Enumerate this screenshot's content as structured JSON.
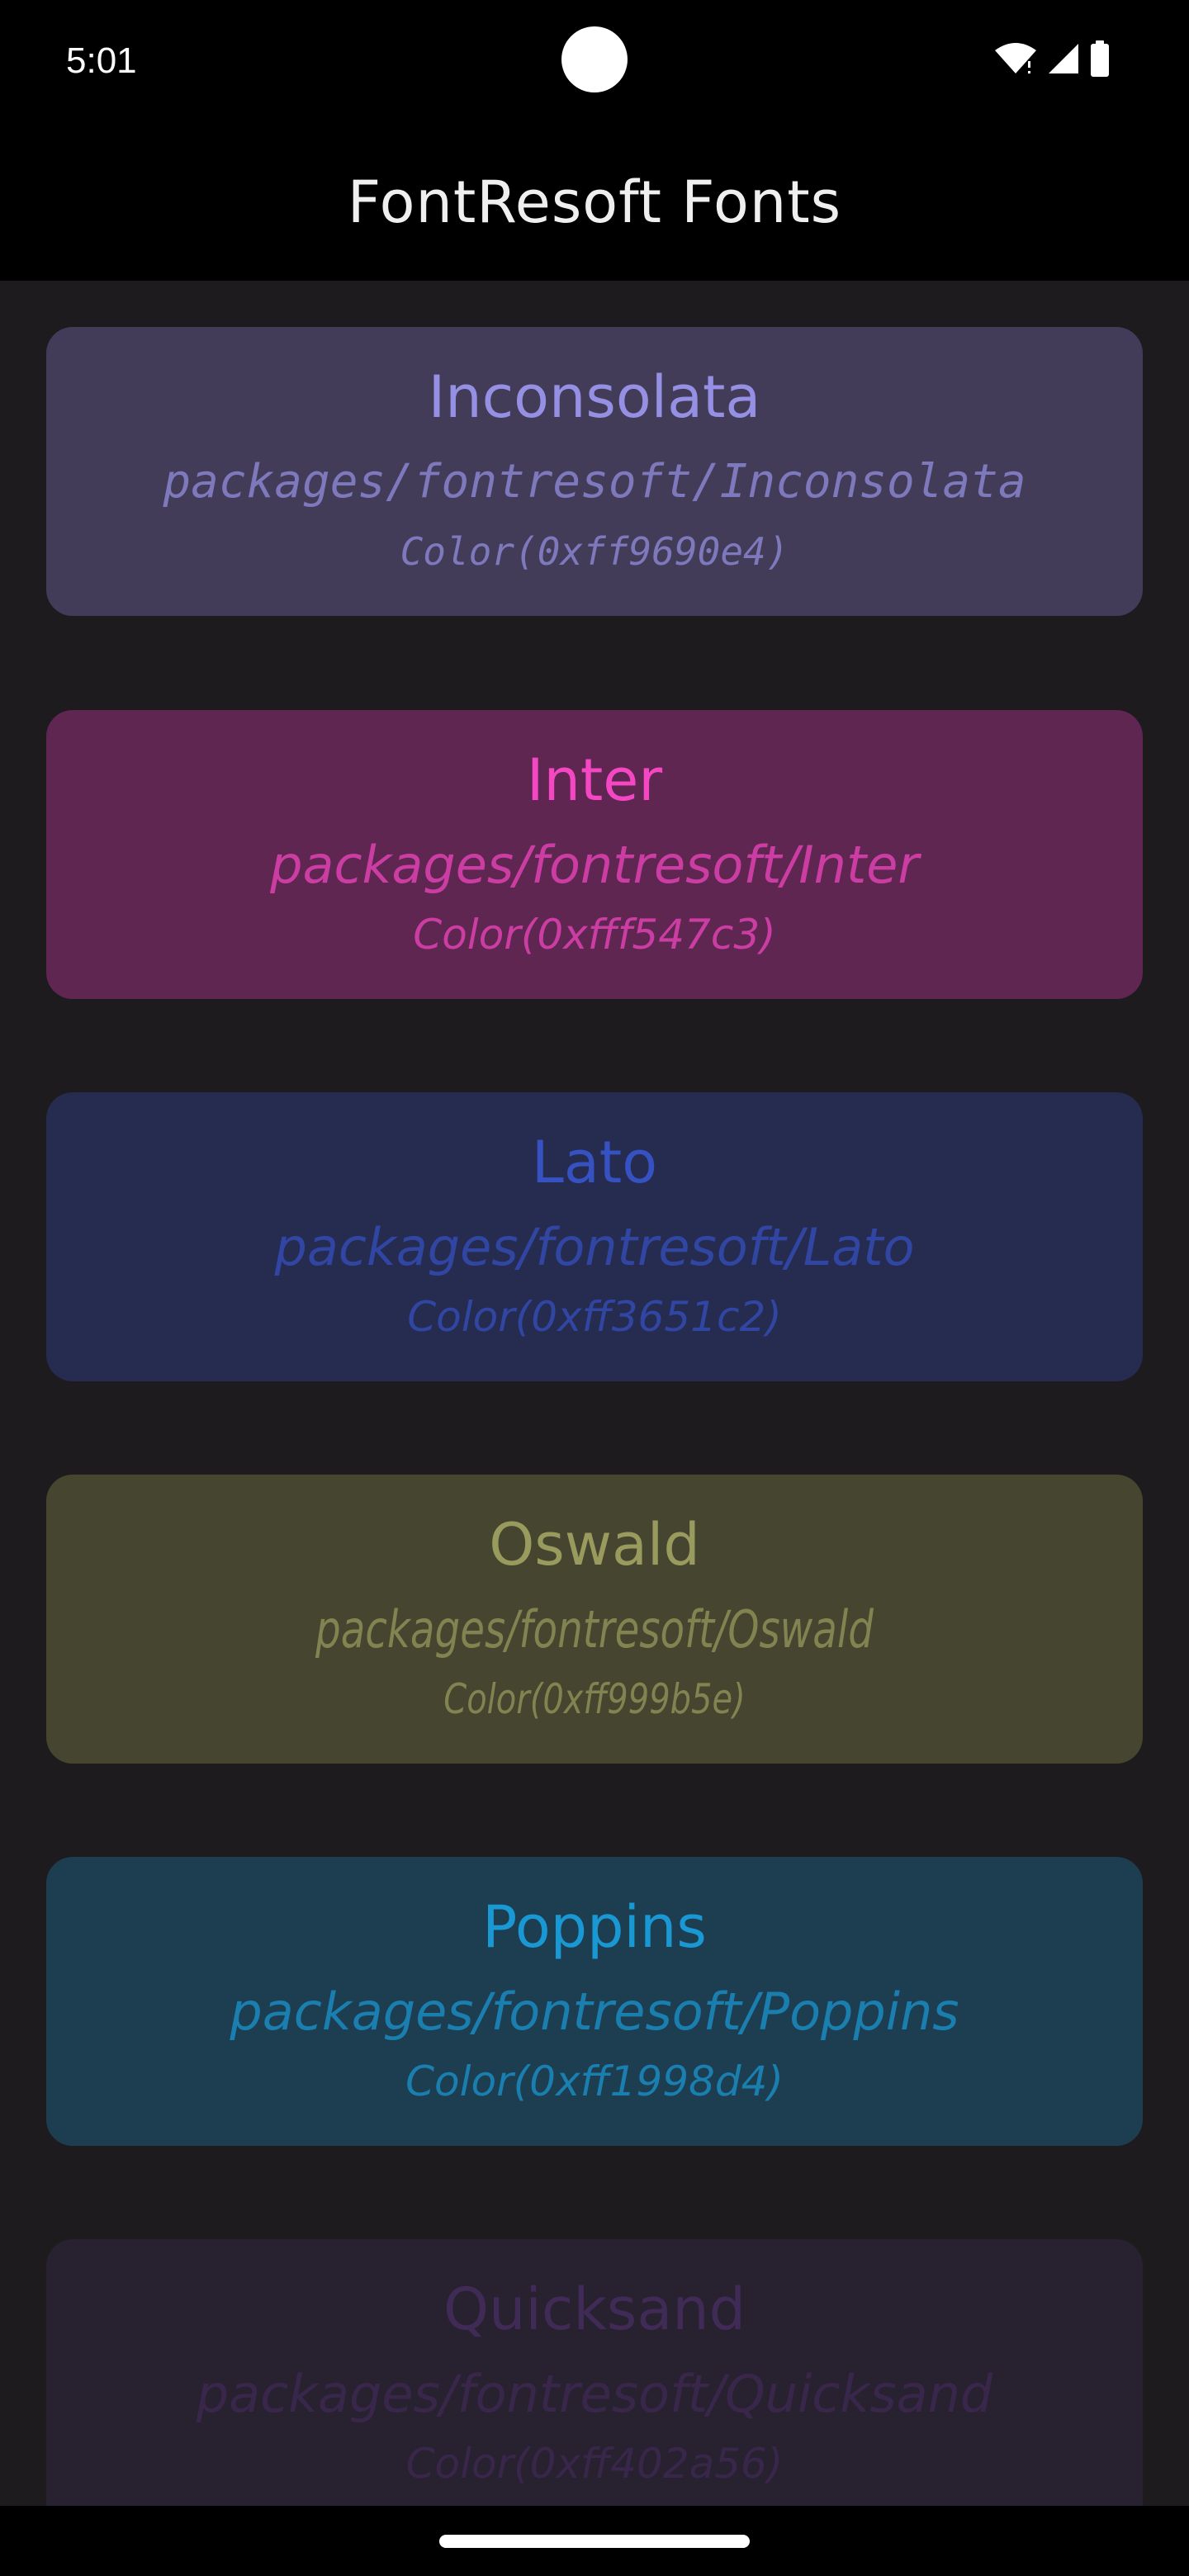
{
  "status_bar": {
    "time": "5:01",
    "icons": [
      "wifi-icon",
      "signal-icon",
      "battery-icon"
    ]
  },
  "app_bar": {
    "title": "FontResoft Fonts"
  },
  "cards": [
    {
      "name": "Inconsolata",
      "path": "packages/fontresoft/Inconsolata",
      "color_label": "Color(0xff9690e4)",
      "accent": "#9690e4",
      "background": "#433c58"
    },
    {
      "name": "Inter",
      "path": "packages/fontresoft/Inter",
      "color_label": "Color(0xfff547c3)",
      "accent": "#f547c3",
      "background": "#5e2650"
    },
    {
      "name": "Lato",
      "path": "packages/fontresoft/Lato",
      "color_label": "Color(0xff3651c2)",
      "accent": "#3651c2",
      "background": "#262b50"
    },
    {
      "name": "Oswald",
      "path": "packages/fontresoft/Oswald",
      "color_label": "Color(0xff999b5e)",
      "accent": "#999b5e",
      "background": "#46452f"
    },
    {
      "name": "Poppins",
      "path": "packages/fontresoft/Poppins",
      "color_label": "Color(0xff1998d4)",
      "accent": "#1998d4",
      "background": "#1d3d51"
    },
    {
      "name": "Quicksand",
      "path": "packages/fontresoft/Quicksand",
      "color_label": "Color(0xff402a56)",
      "accent": "#402a56",
      "background": "#272130"
    }
  ]
}
